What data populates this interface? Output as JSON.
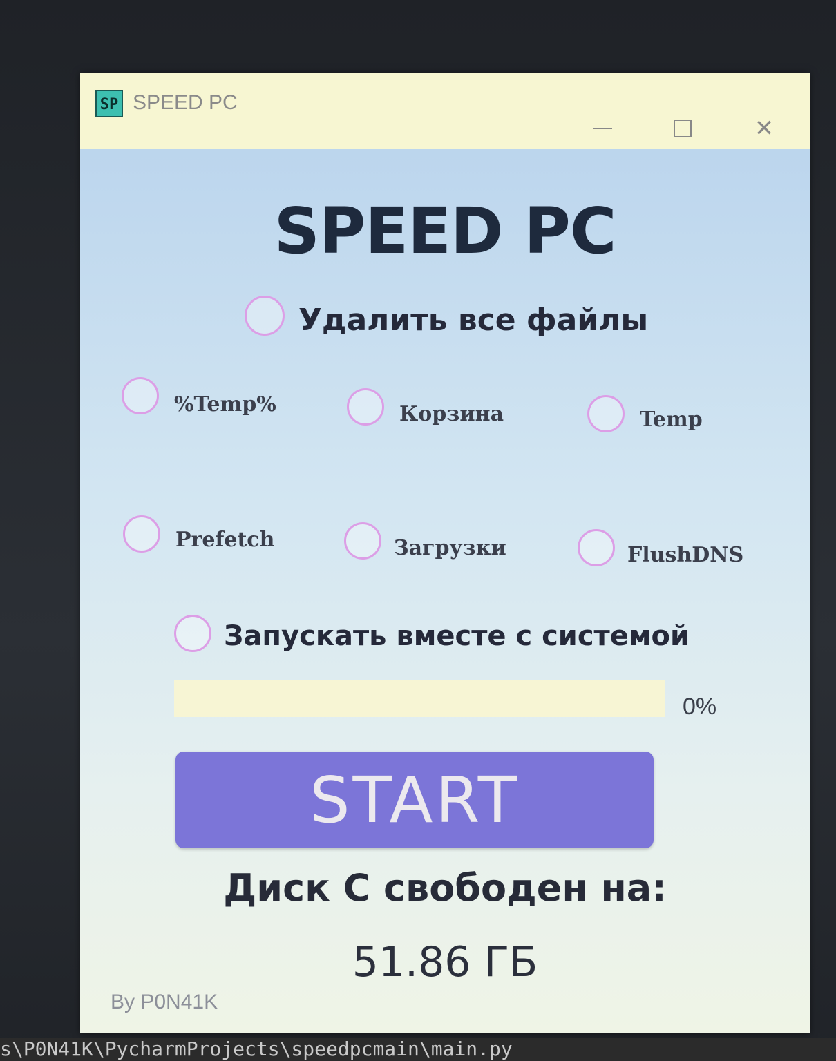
{
  "window": {
    "icon_text": "SP",
    "title": "SPEED PC",
    "minimize_glyph": "—",
    "maximize_glyph": "☐",
    "close_glyph": "✕"
  },
  "app": {
    "heading": "SPEED PC",
    "delete_all_label": "Удалить все файлы",
    "options": [
      {
        "label": "%Temp%",
        "checked": false
      },
      {
        "label": "Корзина",
        "checked": false
      },
      {
        "label": "Temp",
        "checked": false
      },
      {
        "label": "Prefetch",
        "checked": false
      },
      {
        "label": "Загрузки",
        "checked": false
      },
      {
        "label": "FlushDNS",
        "checked": false
      }
    ],
    "autostart_label": "Запускать вместе с системой",
    "progress": {
      "value": 0,
      "text": "0%"
    },
    "start_label": "START",
    "disk_label": "Диск С свободен на:",
    "disk_value": "51.86 ГБ",
    "author": "By P0N41K",
    "accent_color": "#7c75d8",
    "radio_border_color": "#dc9ee6"
  },
  "background": {
    "terminal_path": "s\\P0N41K\\PycharmProjects\\speedpcmain\\main.py"
  }
}
